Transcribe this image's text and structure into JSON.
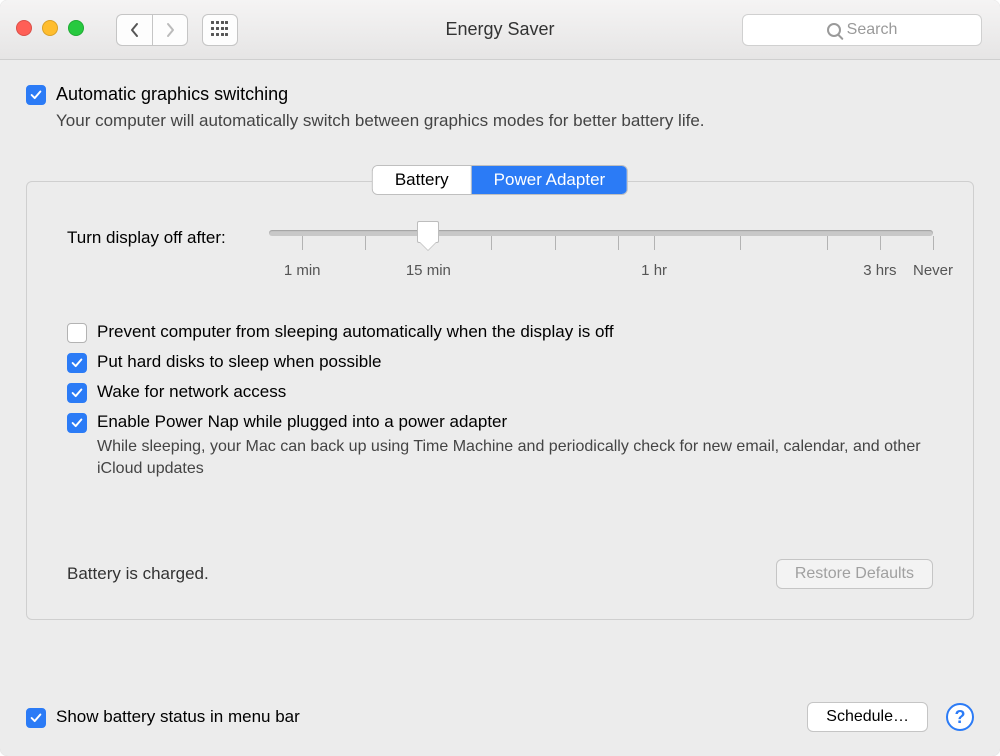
{
  "header": {
    "title": "Energy Saver",
    "search_placeholder": "Search"
  },
  "auto_switch": {
    "label": "Automatic graphics switching",
    "desc": "Your computer will automatically switch between graphics modes for better battery life."
  },
  "tabs": {
    "battery": "Battery",
    "power_adapter": "Power Adapter"
  },
  "slider": {
    "label": "Turn display off after:",
    "ticks": {
      "min1": "1 min",
      "min15": "15 min",
      "hr1": "1 hr",
      "hr3": "3 hrs",
      "never": "Never"
    }
  },
  "options": {
    "prevent_sleep": "Prevent computer from sleeping automatically when the display is off",
    "hard_disks": "Put hard disks to sleep when possible",
    "wake_network": "Wake for network access",
    "power_nap": "Enable Power Nap while plugged into a power adapter",
    "power_nap_desc": "While sleeping, your Mac can back up using Time Machine and periodically check for new email, calendar, and other iCloud updates"
  },
  "footer": {
    "status": "Battery is charged.",
    "restore_defaults": "Restore Defaults"
  },
  "bottom": {
    "show_battery": "Show battery status in menu bar",
    "schedule": "Schedule…",
    "help": "?"
  }
}
